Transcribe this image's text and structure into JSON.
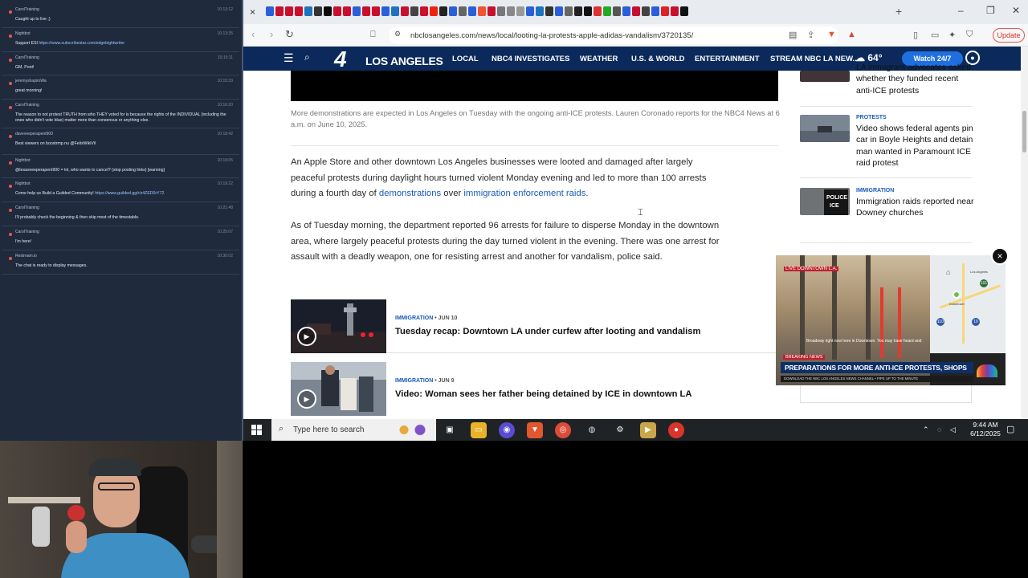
{
  "chat": {
    "messages": [
      {
        "user": "CarolTraining",
        "time": "10:13:12",
        "text": "Caught up to live ;)"
      },
      {
        "user": "Nightbot",
        "time": "10:13:35",
        "text": "Support ESI ",
        "link": "https://www.subscribestar.com/edgebightwriter"
      },
      {
        "user": "CarolTraining",
        "time": "10:15:11",
        "text": "GM, Pont!"
      },
      {
        "user": "jeremyshapiroWa",
        "time": "10:15:33",
        "text": "great morning!"
      },
      {
        "user": "CarolTraining",
        "time": "10:16:20",
        "text": "The reason to not protest TRUTH from who THEY voted for is because the rights of the INDIVIDUAL (including the ones who didn't vote blue) matter more than consensus or anything else."
      },
      {
        "user": "daveveeperapent900",
        "time": "10:18:42",
        "text": "Best viewers on boostrmp.nu @FelixWikiVil"
      },
      {
        "user": "Nightbot",
        "time": "10:19:05",
        "text": "@texasveeperapent900 = lol, who wants to cancel? (stop posting links) [warning]"
      },
      {
        "user": "Nightbot",
        "time": "10:19:22",
        "text": "Come help us Build a Guilded Community! ",
        "link": "https://www.guilded.gg/r/z4ZED0rY72"
      },
      {
        "user": "CarolTraining",
        "time": "10:21:48",
        "text": "I'll probably check the beginning & then skip most of the timestable."
      },
      {
        "user": "CarolTraining",
        "time": "10:25:07",
        "text": "I'm here!"
      },
      {
        "user": "Restream.io",
        "time": "10:30:02",
        "text": "The chat is ready to display messages."
      }
    ]
  },
  "browser": {
    "url": "nbclosangeles.com/news/local/looting-la-protests-apple-adidas-vandalism/3720135/",
    "update_label": "Update",
    "new_tab": "+",
    "close_tab": "×"
  },
  "site": {
    "logo_number": "4",
    "logo_text": "LOS ANGELES",
    "nav": [
      "LOCAL",
      "NBC4 INVESTIGATES",
      "WEATHER",
      "U.S. & WORLD",
      "ENTERTAINMENT",
      "STREAM NBC LA NEW..."
    ],
    "temperature": "64°",
    "watch_label": "Watch 24/7"
  },
  "article": {
    "caption": "More demonstrations are expected in Los Angeles on Tuesday with the ongoing anti-ICE protests. Lauren Coronado reports for the NBC4 News at 6 a.m. on June 10, 2025.",
    "p1_text": "An Apple Store and other downtown Los Angeles businesses were looted and damaged after largely peaceful protests during daylight hours turned violent Monday evening and led to more than 100 arrests during a fourth day of ",
    "p1_link1": "demonstrations",
    "p1_mid": " over ",
    "p1_link2": "immigration enforcement raids",
    "p1_end": ".",
    "p2": "As of Tuesday morning, the department reported 96 arrests for failure to disperse Monday in the downtown area, where largely peaceful protests during the day turned violent in the evening. There was one arrest for assault with a deadly weapon, one for resisting arrest and another for vandalism, police said.",
    "related": [
      {
        "kicker": "IMMIGRATION",
        "date": " • JUN 10",
        "title": "Tuesday recap: Downtown LA under curfew after looting and vandalism"
      },
      {
        "kicker": "IMMIGRATION",
        "date": " • JUN 9",
        "title": "Video: Woman sees her father being detained by ICE in downtown LA"
      }
    ]
  },
  "sidebar": [
    {
      "kicker": "",
      "title": "LA immigrant advocates asked whether they funded recent anti-ICE protests"
    },
    {
      "kicker": "PROTESTS",
      "title": "Video shows federal agents pin car in Boyle Heights and detain man wanted in Paramount ICE raid protest"
    },
    {
      "kicker": "IMMIGRATION",
      "title": "Immigration raids reported near Downey churches"
    }
  ],
  "pip": {
    "live": "LIVE",
    "location": "DOWNTOWN L.A.",
    "sub": "Broadway right now here in Downtown. You may have heard and",
    "breaking": "BREAKING NEWS",
    "headline": "PREPARATIONS FOR MORE ANTI-ICE PROTESTS, SHOPS LOOTED",
    "ticker": "DOWNLOAD THE NBC LOS ANGELES NEWS CHANNEL • PIPE UP TO THE MINUTE",
    "map_labels": [
      "Los Angeles",
      "Downtown"
    ],
    "map_shields": [
      "110",
      "10",
      "101"
    ],
    "close": "×"
  },
  "taskbar": {
    "search_placeholder": "Type here to search",
    "time": "9:44 AM",
    "date": "6/12/2025"
  },
  "colors": {
    "nbc_navy": "#0b2a5b",
    "link_blue": "#1a5bb8",
    "chat_bg": "#1f2a3d"
  }
}
